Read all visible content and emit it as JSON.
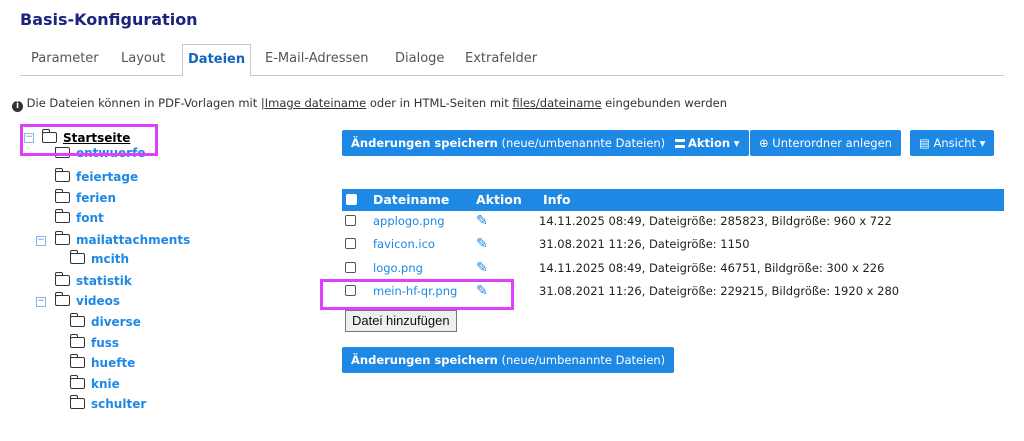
{
  "page_title": "Basis-Konfiguration",
  "tabs": [
    "Parameter",
    "Layout",
    "Dateien",
    "E-Mail-Adressen",
    "Dialoge",
    "Extrafelder"
  ],
  "active_tab": "Dateien",
  "info": {
    "icon": "info-icon",
    "part1": "Die Dateien können in PDF-Vorlagen mit ",
    "link1": "|Image dateiname",
    "part2": " oder in HTML-Seiten mit ",
    "link2": "files/dateiname",
    "part3": " eingebunden werden"
  },
  "tree": {
    "root": "Startseite",
    "items": [
      "entwuerfe",
      "feiertage",
      "ferien",
      "font",
      "mailattachments",
      "mcith",
      "statistik",
      "videos",
      "diverse",
      "fuss",
      "huefte",
      "knie",
      "schulter"
    ]
  },
  "toolbar": {
    "save_bold": "Änderungen speichern",
    "save_thin": " (neue/umbenannte Dateien)",
    "action": "Aktion",
    "new_folder": "Unterordner anlegen",
    "view": "Ansicht"
  },
  "table": {
    "headers": [
      "Dateiname",
      "Aktion",
      "Info"
    ],
    "rows": [
      {
        "name": "applogo.png",
        "info": "14.11.2025 08:49, Dateigröße: 285823, Bildgröße: 960 x 722"
      },
      {
        "name": "favicon.ico",
        "info": "31.08.2021 11:26, Dateigröße: 1150"
      },
      {
        "name": "logo.png",
        "info": "14.11.2025 08:49, Dateigröße: 46751, Bildgröße: 300 x 226"
      },
      {
        "name": "mein-hf-qr.png",
        "info": "31.08.2021 11:26, Dateigröße: 229215, Bildgröße: 1920 x 280"
      }
    ]
  },
  "add_file_label": "Datei hinzufügen",
  "colors": {
    "accent": "#1e88e5",
    "title": "#1a237e",
    "highlight": "#e040fb"
  }
}
